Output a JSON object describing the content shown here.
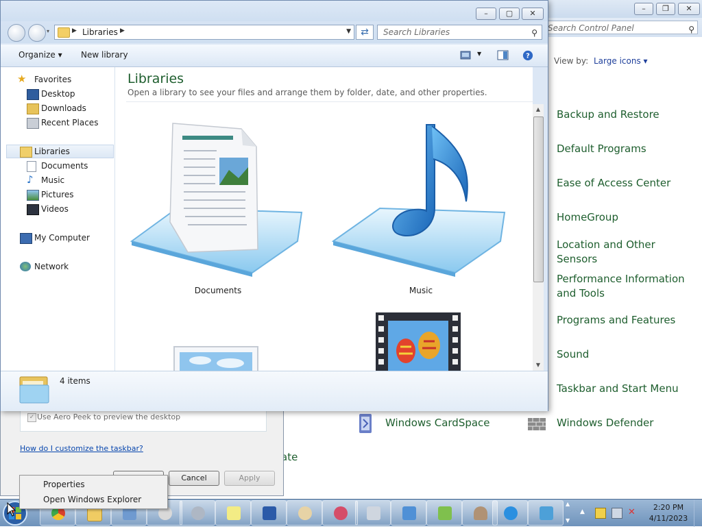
{
  "control_panel": {
    "search_placeholder": "Search Control Panel",
    "view_by_label": "View by:",
    "view_by_value": "Large icons",
    "links": [
      {
        "label": "Backup and Restore"
      },
      {
        "label": "Default Programs"
      },
      {
        "label": "Ease of Access Center"
      },
      {
        "label": "HomeGroup"
      },
      {
        "label": "Location and Other Sensors"
      },
      {
        "label": "Performance Information and Tools"
      },
      {
        "label": "Programs and Features"
      },
      {
        "label": "Sound"
      },
      {
        "label": "Taskbar and Start Menu"
      },
      {
        "label": "Windows Defender"
      },
      {
        "label": "Windows CardSpace"
      }
    ],
    "partial_text": "ate"
  },
  "taskbar_properties": {
    "aero_peek_label": "Use Aero Peek to preview the desktop",
    "help_link": "How do I customize the taskbar?",
    "cancel": "Cancel",
    "apply": "Apply"
  },
  "explorer": {
    "breadcrumb": "Libraries",
    "search_placeholder": "Search Libraries",
    "toolbar": {
      "organize": "Organize",
      "new_library": "New library"
    },
    "nav": {
      "favorites": "Favorites",
      "desktop": "Desktop",
      "downloads": "Downloads",
      "recent_places": "Recent Places",
      "libraries": "Libraries",
      "documents": "Documents",
      "music": "Music",
      "pictures": "Pictures",
      "videos": "Videos",
      "my_computer": "My Computer",
      "network": "Network"
    },
    "content": {
      "title": "Libraries",
      "subtitle": "Open a library to see your files and arrange them by folder, date, and other properties.",
      "libraries": [
        {
          "name": "Documents"
        },
        {
          "name": "Music"
        }
      ]
    },
    "details": {
      "count": "4 items"
    }
  },
  "context_menu": {
    "items": [
      "Properties",
      "Open Windows Explorer"
    ]
  },
  "clock": {
    "time": "2:20 PM",
    "date": "4/11/2023"
  }
}
